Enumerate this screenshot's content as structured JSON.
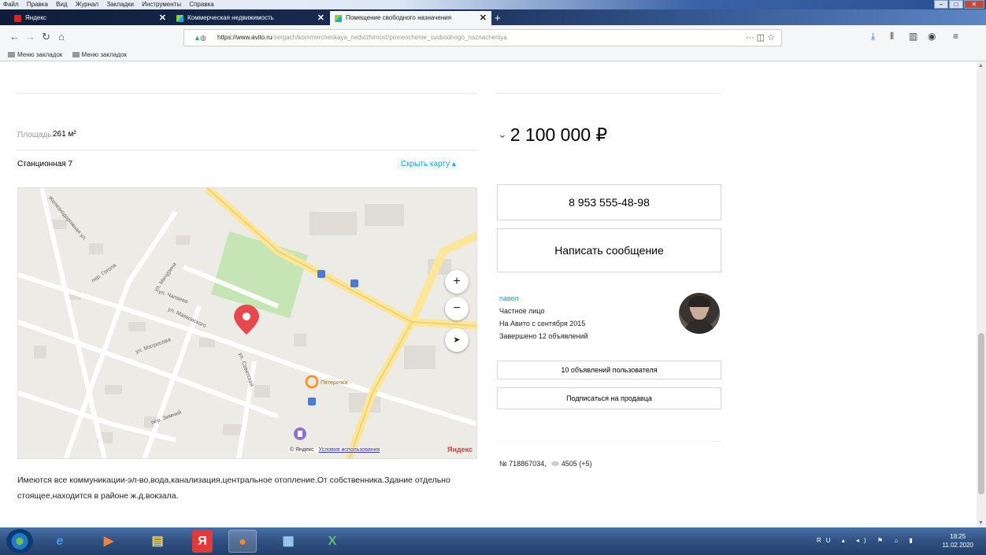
{
  "browser": {
    "menu": [
      "Файл",
      "Правка",
      "Вид",
      "Журнал",
      "Закладки",
      "Инструменты",
      "Справка"
    ],
    "tabs": [
      {
        "title": "Яндекс",
        "close": "✕"
      },
      {
        "title": "Коммерческая недвижимость",
        "close": "✕"
      },
      {
        "title": "Помещение свободного назначения",
        "close": "✕"
      }
    ],
    "new_tab": "+",
    "url_domain": "https://www.avito.ru",
    "url_path": "/sergach/kommercheskaya_nedvizhimost/pomeschenie_svobodnogo_naznacheniya",
    "bookmarks": [
      "Меню закладок",
      "Меню закладок"
    ]
  },
  "listing": {
    "area_label": "Площадь:",
    "area_value": "261 м²",
    "address": "Станционная 7",
    "hide_map": "Скрыть карту",
    "description": "Имеются все коммуникации-эл-во,вода,канализация,центральное отопление.От собственника.Здание отдельно стоящее,находится в районе ж.д.вокзала.",
    "price": "2 100 000 ₽",
    "phone": "8 953 555-48-98",
    "write_message": "Написать сообщение",
    "seller": {
      "name": "павел",
      "type": "Частное лицо",
      "since": "На Авито с сентября 2015",
      "completed": "Завершено 12 объявлений"
    },
    "user_ads": "10 объявлений пользователя",
    "subscribe": "Подписаться на продавца",
    "ad_number": "№ 718867034,",
    "views": "4505 (+5)"
  },
  "map": {
    "plus": "+",
    "minus": "−",
    "locate": "➤",
    "copyright": "© Яндекс",
    "terms": "Условия использования",
    "logo": "Яндекс",
    "poi_label": "Пятерочка",
    "street_labels": [
      "ул. Чапаева",
      "пер. Гоголя",
      "ул. Мичурина",
      "ул. Маяковского",
      "ул. Матросова",
      "пер. Зимний",
      "ул. Советская",
      "Железнодорожная ул."
    ]
  },
  "taskbar": {
    "lang": "RU",
    "time": "18:25",
    "date": "11.02.2020"
  },
  "colors": {
    "link": "#00aaff",
    "pin": "#e8474c",
    "park": "#c5e5b4"
  }
}
